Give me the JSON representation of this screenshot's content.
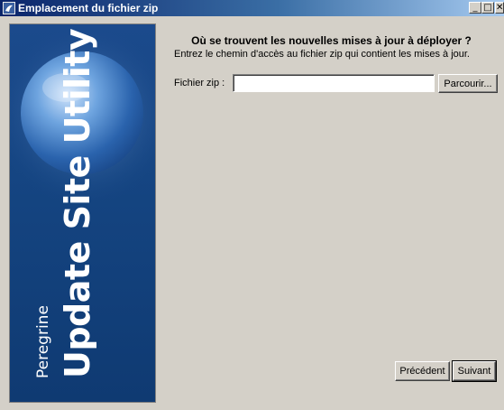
{
  "window": {
    "title": "Emplacement du fichier zip",
    "controls": {
      "minimize": "_",
      "maximize": "□",
      "close": "✕"
    }
  },
  "banner": {
    "product": "Update Site Utility",
    "brand": "Peregrine",
    "emblem": "6"
  },
  "main": {
    "heading": "Où se trouvent les nouvelles mises à jour à déployer ?",
    "instruction": "Entrez le chemin d'accès au fichier zip qui contient les mises à jour.",
    "zip_label": "Fichier zip :",
    "zip_value": "",
    "browse_label": "Parcourir..."
  },
  "footer": {
    "previous_label": "Précédent",
    "next_label": "Suivant"
  },
  "colors": {
    "titlebar_start": "#0a246a",
    "titlebar_end": "#a6caf0",
    "face": "#d4d0c8",
    "banner": "#154582"
  }
}
